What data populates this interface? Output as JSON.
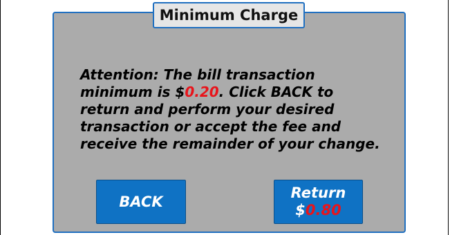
{
  "dialog": {
    "title": "Minimum Charge",
    "message_prefix": "Attention: The bill transaction minimum is $",
    "minimum_amount": "0.20",
    "message_suffix": ". Click BACK to return and perform your desired transaction or accept the fee and receive the remainder of your change."
  },
  "buttons": {
    "back_label": "BACK",
    "return_label": "Return",
    "return_currency": "$",
    "return_amount": "0.80"
  },
  "colors": {
    "dialog_background": "#ababab",
    "accent_border": "#1f6fc0",
    "button_blue": "#0f72c4",
    "highlight_red": "#e8141b",
    "title_background": "#e6e6e6"
  }
}
